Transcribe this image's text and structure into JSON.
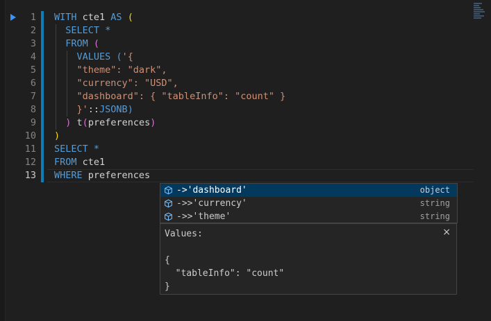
{
  "editor": {
    "line_numbers": [
      "1",
      "2",
      "3",
      "4",
      "5",
      "6",
      "7",
      "8",
      "9",
      "10",
      "11",
      "12",
      "13"
    ],
    "active_line": "13",
    "lines": [
      [
        {
          "c": "kw",
          "t": "WITH"
        },
        {
          "c": "tx",
          "t": " cte1 "
        },
        {
          "c": "kw",
          "t": "AS"
        },
        {
          "c": "tx",
          "t": " "
        },
        {
          "c": "p1",
          "t": "("
        }
      ],
      [
        {
          "c": "tx",
          "t": "  "
        },
        {
          "c": "kw",
          "t": "SELECT"
        },
        {
          "c": "tx",
          "t": " "
        },
        {
          "c": "kw",
          "t": "*"
        }
      ],
      [
        {
          "c": "tx",
          "t": "  "
        },
        {
          "c": "kw",
          "t": "FROM"
        },
        {
          "c": "tx",
          "t": " "
        },
        {
          "c": "p2",
          "t": "("
        }
      ],
      [
        {
          "c": "tx",
          "t": "    "
        },
        {
          "c": "kw",
          "t": "VALUES"
        },
        {
          "c": "tx",
          "t": " "
        },
        {
          "c": "kw",
          "t": "("
        },
        {
          "c": "st",
          "t": "'{"
        }
      ],
      [
        {
          "c": "st",
          "t": "    \"theme\": \"dark\","
        }
      ],
      [
        {
          "c": "st",
          "t": "    \"currency\": \"USD\","
        }
      ],
      [
        {
          "c": "st",
          "t": "    \"dashboard\": { \"tableInfo\": \"count\" }"
        }
      ],
      [
        {
          "c": "st",
          "t": "    }'"
        },
        {
          "c": "tx",
          "t": "::"
        },
        {
          "c": "kw",
          "t": "JSONB"
        },
        {
          "c": "kw",
          "t": ")"
        }
      ],
      [
        {
          "c": "tx",
          "t": "  "
        },
        {
          "c": "p2",
          "t": ")"
        },
        {
          "c": "tx",
          "t": " t"
        },
        {
          "c": "p2",
          "t": "("
        },
        {
          "c": "tx",
          "t": "preferences"
        },
        {
          "c": "p2",
          "t": ")"
        }
      ],
      [
        {
          "c": "p1",
          "t": ")"
        }
      ],
      [
        {
          "c": "kw",
          "t": "SELECT"
        },
        {
          "c": "tx",
          "t": " "
        },
        {
          "c": "kw",
          "t": "*"
        }
      ],
      [
        {
          "c": "kw",
          "t": "FROM"
        },
        {
          "c": "tx",
          "t": " cte1"
        }
      ],
      [
        {
          "c": "kw",
          "t": "WHERE"
        },
        {
          "c": "tx",
          "t": " preferences"
        }
      ]
    ]
  },
  "suggestions": [
    {
      "label": "->'dashboard'",
      "type": "object",
      "icon": "cube-icon",
      "selected": true
    },
    {
      "label": "->>'currency'",
      "type": "string",
      "icon": "cube-icon",
      "selected": false
    },
    {
      "label": "->>'theme'",
      "type": "string",
      "icon": "cube-icon",
      "selected": false
    }
  ],
  "details": {
    "title": "Values:",
    "close": "×",
    "body": "{\n  \"tableInfo\": \"count\"\n}"
  },
  "colors": {
    "keyword": "#569cd6",
    "string": "#ce9178",
    "bracket_1": "#ffd700",
    "bracket_2": "#da70d6",
    "selection": "#04395e",
    "accent": "#0e7db3"
  }
}
